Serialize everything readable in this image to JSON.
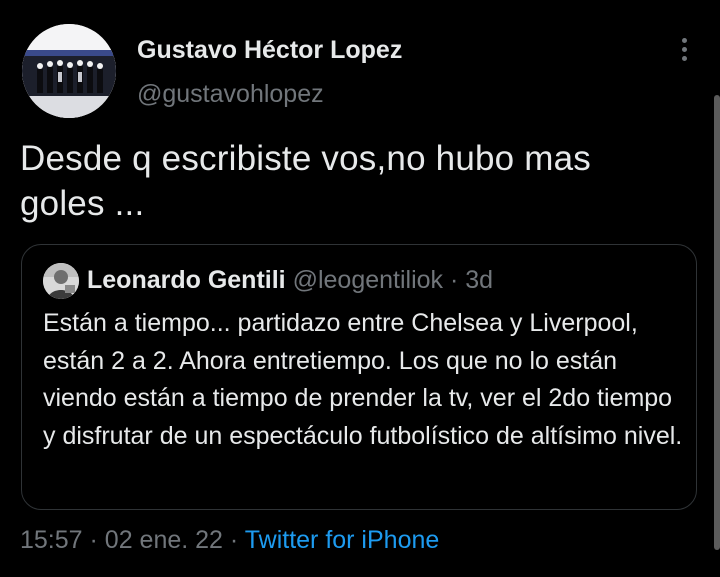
{
  "author": {
    "display_name": "Gustavo Héctor Lopez",
    "handle": "@gustavohlopez",
    "avatar_icon": "group-photo-avatar"
  },
  "menu_icon": "more-options-icon",
  "tweet": {
    "text": "Desde q escribiste vos,no hubo mas goles ..."
  },
  "quoted_tweet": {
    "display_name": "Leonardo Gentili",
    "handle": "@leogentiliok",
    "separator": "·",
    "time": "3d",
    "text": "Están a tiempo... partidazo entre Chelsea y Liverpool, están 2 a 2. Ahora entretiempo. Los que no lo están viendo están a tiempo de prender la tv, ver el 2do tiempo y disfrutar de un espectáculo futbolístico de altísimo nivel."
  },
  "meta": {
    "time": "15:57",
    "separator1": "·",
    "date": "02 ene. 22",
    "separator2": "·",
    "source": "Twitter for iPhone"
  },
  "colors": {
    "background": "#000000",
    "text": "#e7e9ea",
    "secondary": "#71767b",
    "link": "#1d9bf0",
    "border": "#2f3336"
  }
}
